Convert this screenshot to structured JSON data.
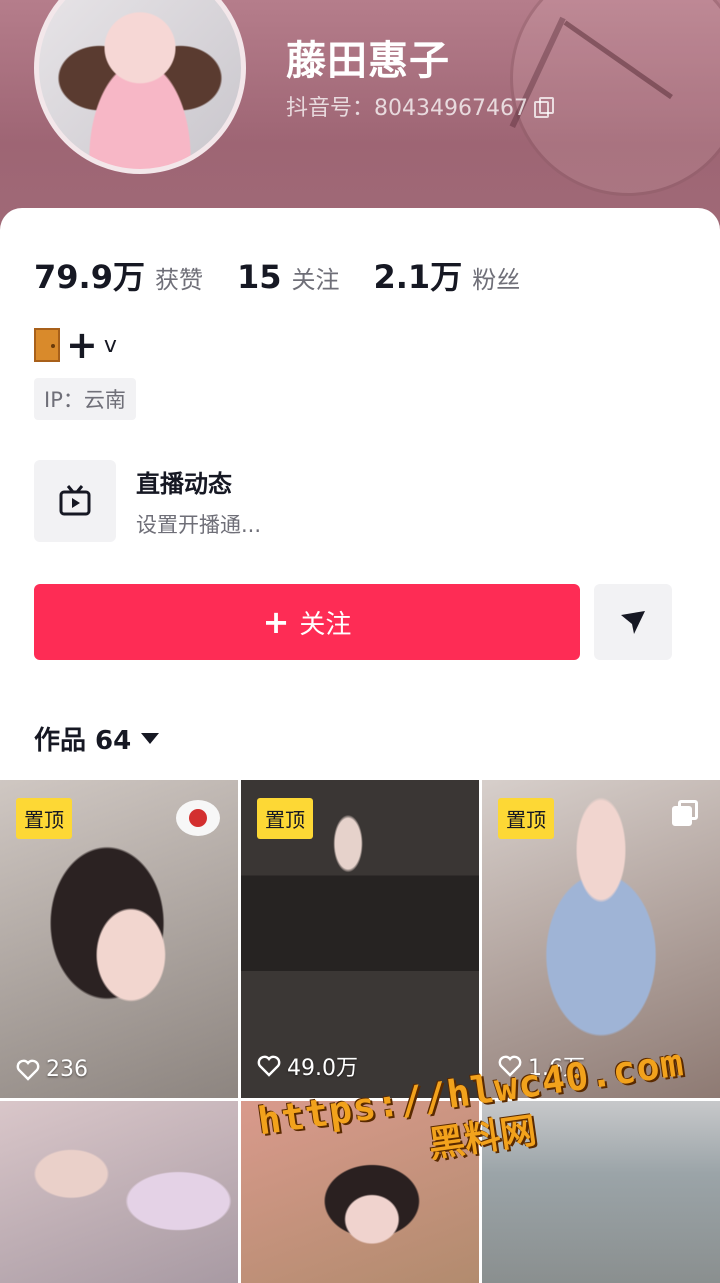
{
  "profile": {
    "name": "藤田惠子",
    "douyin_id": "抖音号：80434967467"
  },
  "stats": [
    {
      "value": "79.9万",
      "label": "获赞"
    },
    {
      "value": "15",
      "label": "关注"
    },
    {
      "value": "2.1万",
      "label": "粉丝"
    }
  ],
  "bio": {
    "icons": [
      "door-icon",
      "plus-icon"
    ],
    "text": "v"
  },
  "ip_tag": "IP：云南",
  "live": {
    "title": "直播动态",
    "subtitle": "设置开播通..."
  },
  "actions": {
    "follow_label": "关注",
    "message_icon": "send-icon"
  },
  "works_tab": {
    "label": "作品 64"
  },
  "grid": [
    {
      "pinned": "置顶",
      "likes": "236",
      "badge": "apple-sticker"
    },
    {
      "pinned": "置顶",
      "likes": "49.0万"
    },
    {
      "pinned": "置顶",
      "likes": "1.6万",
      "badge": "multi-image-icon"
    },
    {},
    {},
    {}
  ],
  "watermark": {
    "url": "https://hlwc40.com",
    "site": "黑料网"
  },
  "colors": {
    "accent": "#fe2c55",
    "pin": "#fdd835",
    "banner": "#a06a77"
  }
}
